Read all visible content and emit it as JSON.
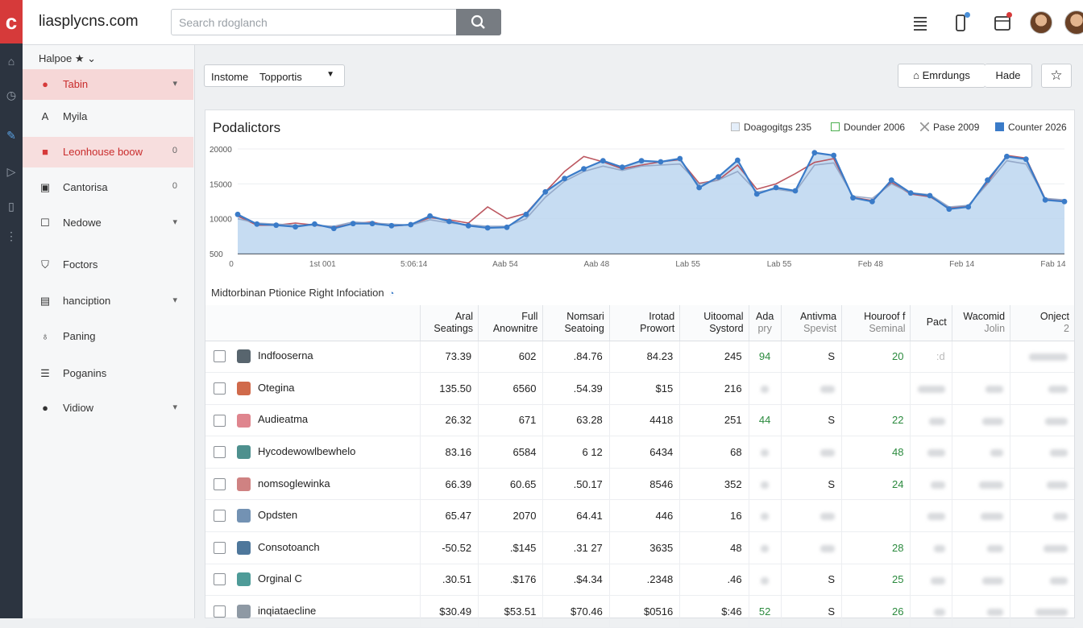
{
  "app": {
    "brand": "liasplycns.com",
    "logo_glyph": "c",
    "search_placeholder": "Search rdoglanch"
  },
  "icons": {
    "search": "search-icon",
    "list": "list-icon",
    "phone": "phone-icon",
    "calendar": "calendar-icon",
    "home": "home-icon",
    "star": "star-icon"
  },
  "colors": {
    "accent_red": "#d63a3a",
    "series_blue": "#3a7bc8",
    "series_red": "#b5454f",
    "area_fill": "#bcd6f0",
    "positive_green": "#2b8a3e"
  },
  "sidebar": {
    "header": "Halpoe",
    "items": [
      {
        "icon": "map-pin-icon",
        "label": "Tabin",
        "trail": "▾",
        "state": "active"
      },
      {
        "icon": "person-icon",
        "label": "Myila",
        "trail": "",
        "state": ""
      },
      {
        "icon": "inbox-icon",
        "label": "Leonhouse boow",
        "trail": "0",
        "state": "active2"
      },
      {
        "icon": "square-icon",
        "label": "Cantorisa",
        "trail": "0",
        "state": ""
      },
      {
        "icon": "checkbox-icon",
        "label": "Nedowe",
        "trail": "▾",
        "state": ""
      },
      {
        "icon": "filter-icon",
        "label": "Foctors",
        "trail": "",
        "state": ""
      },
      {
        "icon": "layers-icon",
        "label": "hanciption",
        "trail": "▾",
        "state": ""
      },
      {
        "icon": "bell-icon",
        "label": "Paning",
        "trail": "",
        "state": ""
      },
      {
        "icon": "list-icon",
        "label": "Poganins",
        "trail": "",
        "state": ""
      },
      {
        "icon": "user-icon",
        "label": "Vidiow",
        "trail": "▾",
        "state": ""
      }
    ]
  },
  "toolbar": {
    "segment_a": "Instome",
    "segment_b": "Topportis",
    "btn_primary": "Emrdungs",
    "btn_secondary": "Hade"
  },
  "chart_data": {
    "type": "area",
    "title": "Podalictors",
    "legend": [
      {
        "label": "Doagogitgs 235",
        "color": "#7fa6d6",
        "style": "check"
      },
      {
        "label": "Dounder 2006",
        "color": "#4caf50",
        "style": "box"
      },
      {
        "label": "Pase 2009",
        "color": "#999999",
        "style": "x"
      },
      {
        "label": "Counter 2026",
        "color": "#3a7bc8",
        "style": "fill"
      }
    ],
    "y_ticks": [
      "20000",
      "15000",
      "10000",
      "500"
    ],
    "x_ticks": [
      "0",
      "1st 001",
      "5:06:14",
      "Aab 54",
      "Aab 48",
      "Lab 55",
      "Lab 55",
      "Feb 48",
      "Feb 14",
      "Fab 14"
    ],
    "ylim": [
      500,
      20000
    ],
    "series": [
      {
        "name": "Counter 2026",
        "values": [
          7800,
          6000,
          5800,
          5500,
          6000,
          5200,
          6100,
          6100,
          5700,
          5900,
          7500,
          6500,
          5700,
          5300,
          5400,
          7800,
          12000,
          14500,
          16300,
          17800,
          16600,
          17800,
          17600,
          18200,
          12800,
          14800,
          17900,
          11600,
          12800,
          12200,
          19300,
          18800,
          10900,
          10200,
          14200,
          11800,
          11300,
          8800,
          9200,
          14200,
          18600,
          18100,
          10500,
          10200
        ]
      },
      {
        "name": "Pase 2009",
        "values": [
          7000,
          6200,
          6000,
          5800,
          5800,
          5600,
          6400,
          6200,
          6000,
          5800,
          6800,
          6200,
          5900,
          5600,
          5600,
          7000,
          11000,
          14000,
          15800,
          16800,
          16000,
          16800,
          17000,
          17200,
          13400,
          14200,
          15800,
          12000,
          12500,
          12000,
          17000,
          17400,
          11200,
          10800,
          13500,
          11800,
          11500,
          9200,
          9500,
          13500,
          17800,
          17200,
          10800,
          10500
        ]
      },
      {
        "name": "Dounder 2006",
        "values": [
          7500,
          5800,
          5800,
          6200,
          5800,
          5400,
          6100,
          6400,
          5600,
          5900,
          7200,
          6800,
          6200,
          9200,
          7000,
          8000,
          12000,
          15800,
          18600,
          17600,
          16300,
          17000,
          17600,
          18000,
          13600,
          14200,
          17000,
          12500,
          13500,
          15400,
          17500,
          18200,
          11000,
          10400,
          13800,
          11600,
          11100,
          9000,
          9400,
          13800,
          18800,
          18300,
          10700,
          10300
        ]
      }
    ]
  },
  "table": {
    "section_title": "Midtorbinan Ptionice Right Infociation",
    "columns": [
      {
        "l1": "",
        "l2": ""
      },
      {
        "l1": "Aral",
        "l2": "Seatings"
      },
      {
        "l1": "Full",
        "l2": "Anownitre"
      },
      {
        "l1": "Nomsari",
        "l2": "Seatoing"
      },
      {
        "l1": "Irotad",
        "l2": "Prowort"
      },
      {
        "l1": "Uitoomal",
        "l2": "Systord"
      },
      {
        "l1": "Ada",
        "l2": "pry"
      },
      {
        "l1": "Antivma",
        "l2": "Spevist"
      },
      {
        "l1": "Houroof f",
        "l2": "Seminal"
      },
      {
        "l1": "Pact",
        "l2": ""
      },
      {
        "l1": "Wacomid",
        "l2": "Jolin"
      },
      {
        "l1": "Onject",
        "l2": "2"
      }
    ],
    "rows": [
      {
        "icon_color": "#3b4a55",
        "name": "Indfooserna",
        "c1": "73.39",
        "c2": "602",
        "c3": ".84.76",
        "c4": "84.23",
        "c5": "245",
        "c6": "94",
        "c7": "S",
        "c8": "20",
        "c9": ":d",
        "c10": "",
        "c11": ""
      },
      {
        "icon_color": "#c8502c",
        "name": "Otegina",
        "c1": "135.50",
        "c2": "6560",
        "c3": ".54.39",
        "c4": "$15",
        "c5": "216",
        "c6": "",
        "c7": "",
        "c8": "",
        "c9": "",
        "c10": "",
        "c11": ""
      },
      {
        "icon_color": "#d9707a",
        "name": "Audieatma",
        "c1": "26.32",
        "c2": "671",
        "c3": "63.28",
        "c4": "4418",
        "c5": "251",
        "c6": "44",
        "c7": "S",
        "c8": "22",
        "c9": "",
        "c10": "",
        "c11": ""
      },
      {
        "icon_color": "#2f7d7a",
        "name": "Hycodewowlbewhelo",
        "c1": "83.16",
        "c2": "6584",
        "c3": "6 12",
        "c4": "6434",
        "c5": "68",
        "c6": "",
        "c7": "",
        "c8": "48",
        "c9": "",
        "c10": "",
        "c11": ""
      },
      {
        "icon_color": "#c76c6c",
        "name": "nomsoglewinka",
        "c1": "66.39",
        "c2": "60.65",
        "c3": ".50.17",
        "c4": "8546",
        "c5": "352",
        "c6": "",
        "c7": "S",
        "c8": "24",
        "c9": "",
        "c10": "",
        "c11": ""
      },
      {
        "icon_color": "#5b7fa6",
        "name": "Opdsten",
        "c1": "65.47",
        "c2": "2070",
        "c3": "64.41",
        "c4": "446",
        "c5": "16",
        "c6": "",
        "c7": "",
        "c8": "",
        "c9": "",
        "c10": "",
        "c11": ""
      },
      {
        "icon_color": "#2f5f8a",
        "name": "Consotoanch",
        "c1": "-50.52",
        "c2": ".$145",
        "c3": ".31 27",
        "c4": "3635",
        "c5": "48",
        "c6": "",
        "c7": "",
        "c8": "28",
        "c9": "",
        "c10": "",
        "c11": ""
      },
      {
        "icon_color": "#2f8a86",
        "name": "Orginal C",
        "c1": ".30.51",
        "c2": ".$176",
        "c3": ".$4.34",
        "c4": ".2348",
        "c5": ".46",
        "c6": "",
        "c7": "S",
        "c8": "25",
        "c9": "",
        "c10": "",
        "c11": ""
      },
      {
        "icon_color": "#7a8794",
        "name": "inqiataecline",
        "c1": "$30.49",
        "c2": "$53.51",
        "c3": "$70.46",
        "c4": "$0516",
        "c5": "$:46",
        "c6": "52",
        "c7": "S",
        "c8": "26",
        "c9": "",
        "c10": "",
        "c11": ""
      }
    ]
  }
}
